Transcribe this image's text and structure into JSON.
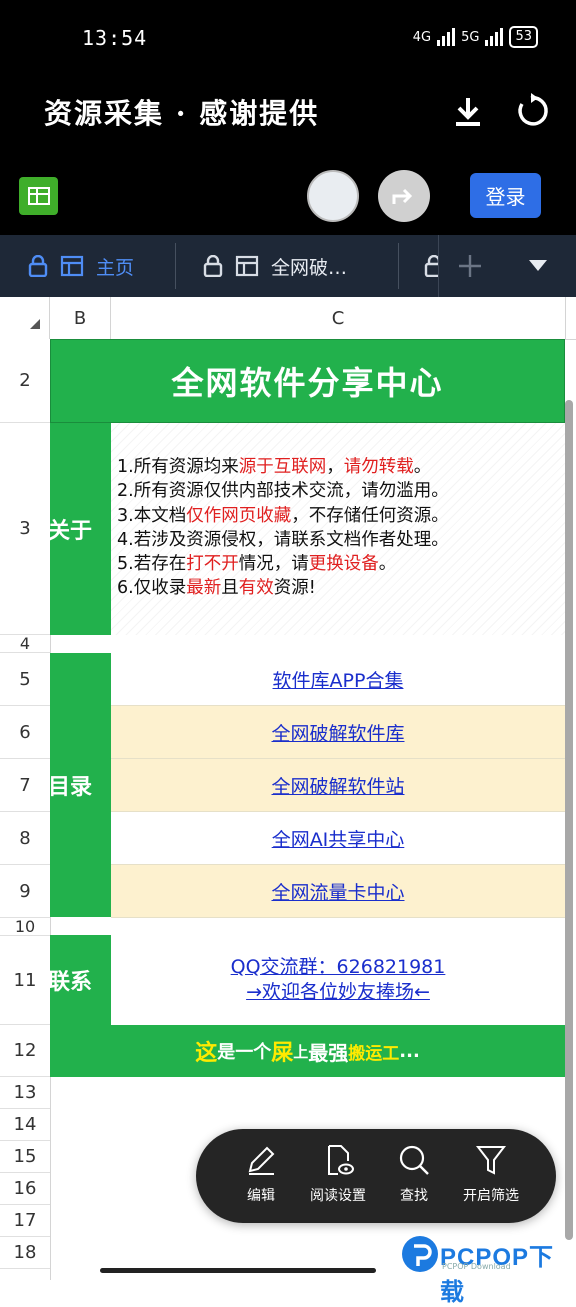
{
  "status": {
    "time": "13:54",
    "net1": "4G",
    "net2": "5G",
    "battery": "53"
  },
  "header": {
    "title": "资源采集 · 感谢提供"
  },
  "actions": {
    "login": "登录"
  },
  "tabs": [
    {
      "label": "主页"
    },
    {
      "label": "全网破…"
    }
  ],
  "columns": [
    "B",
    "C"
  ],
  "rows": [
    "2",
    "3",
    "4",
    "5",
    "6",
    "7",
    "8",
    "9",
    "10",
    "11",
    "12",
    "13",
    "14",
    "15",
    "16",
    "17",
    "18"
  ],
  "sheet": {
    "title": "全网软件分享中心",
    "about_label": "关于",
    "about_lines": [
      {
        "parts": [
          {
            "t": "1.所有资源均来",
            "c": "n"
          },
          {
            "t": "源于互联网",
            "c": "r"
          },
          {
            "t": "，",
            "c": "n"
          },
          {
            "t": "请勿转载",
            "c": "r"
          },
          {
            "t": "。",
            "c": "n"
          }
        ]
      },
      {
        "parts": [
          {
            "t": "2.所有资源仅供内部技术交流，请勿滥用。",
            "c": "n"
          }
        ]
      },
      {
        "parts": [
          {
            "t": "3.本文档",
            "c": "n"
          },
          {
            "t": "仅作网页收藏",
            "c": "r"
          },
          {
            "t": "，不存储任何资源。",
            "c": "n"
          }
        ]
      },
      {
        "parts": [
          {
            "t": "4.若涉及资源侵权，请联系文档作者处理。",
            "c": "n"
          }
        ]
      },
      {
        "parts": [
          {
            "t": "5.若存在",
            "c": "n"
          },
          {
            "t": "打不开",
            "c": "r"
          },
          {
            "t": "情况，请",
            "c": "n"
          },
          {
            "t": "更换设备",
            "c": "r"
          },
          {
            "t": "。",
            "c": "n"
          }
        ]
      },
      {
        "parts": [
          {
            "t": "6.仅收录",
            "c": "n"
          },
          {
            "t": "最新",
            "c": "r"
          },
          {
            "t": "且",
            "c": "n"
          },
          {
            "t": "有效",
            "c": "r"
          },
          {
            "t": "资源!",
            "c": "n"
          }
        ]
      }
    ],
    "menu_label": "目录",
    "links": [
      "软件库APP合集",
      "全网破解软件库",
      "全网破解软件站",
      "全网AI共享中心",
      "全网流量卡中心"
    ],
    "contact_label": "联系",
    "contact_lines": [
      "QQ交流群：626821981",
      "→欢迎各位妙友捧场←"
    ],
    "footer_parts": [
      "这",
      "是一个",
      "屎",
      "上",
      "最强",
      "搬运工",
      "..."
    ]
  },
  "toolbar": {
    "edit": "编辑",
    "read": "阅读设置",
    "find": "查找",
    "filter": "开启筛选"
  },
  "watermark": {
    "text": "PCPOP下载",
    "sub": "PCPOP Download"
  },
  "colors": {
    "green": "#22b14c",
    "link": "#1a2ecc",
    "red": "#e02020",
    "yellow_row": "#fdf1cf",
    "accent": "#2e6ee6"
  }
}
